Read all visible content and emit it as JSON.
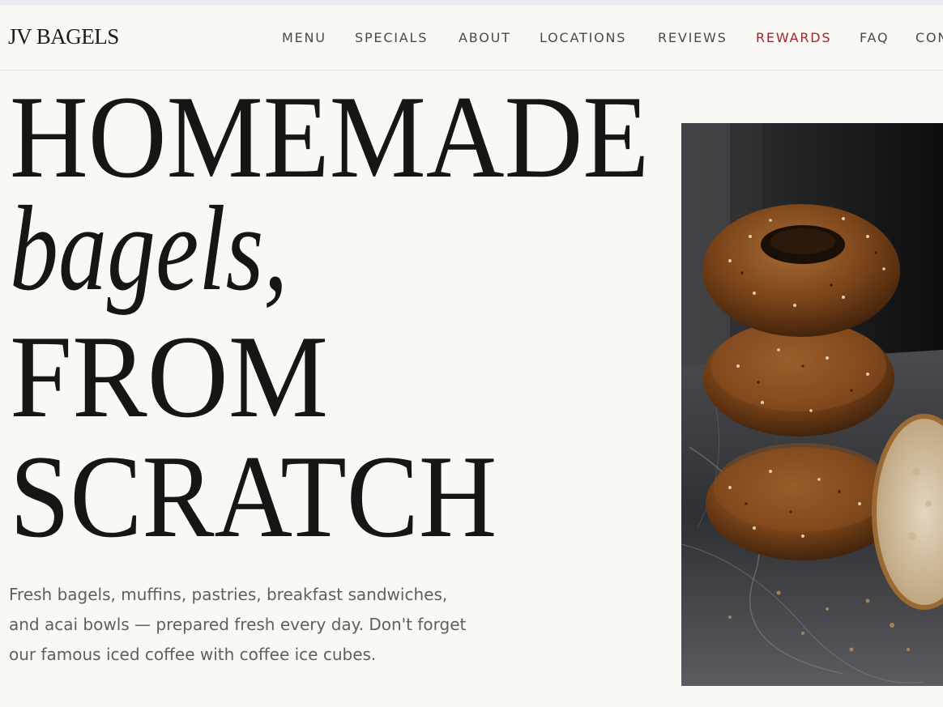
{
  "brand": {
    "logo_text": "JV BAGELS"
  },
  "nav": {
    "items": [
      {
        "label": "MENU"
      },
      {
        "label": "SPECIALS"
      },
      {
        "label": "ABOUT"
      },
      {
        "label": "LOCATIONS"
      },
      {
        "label": "REVIEWS"
      },
      {
        "label": "REWARDS"
      },
      {
        "label": "FAQ"
      },
      {
        "label": "CON"
      }
    ]
  },
  "hero": {
    "line1": "HOMEMADE",
    "line2": "bagels,",
    "line3": "FROM",
    "line4": "SCRATCH",
    "description": "Fresh bagels, muffins, pastries, breakfast sandwiches, and acai bowls — prepared fresh every day. Don't forget our famous iced coffee with coffee ice cubes."
  },
  "colors": {
    "background": "#f9f8f4",
    "accent": "#a3242e",
    "text": "#161614",
    "muted_text": "#5f5f5c"
  }
}
